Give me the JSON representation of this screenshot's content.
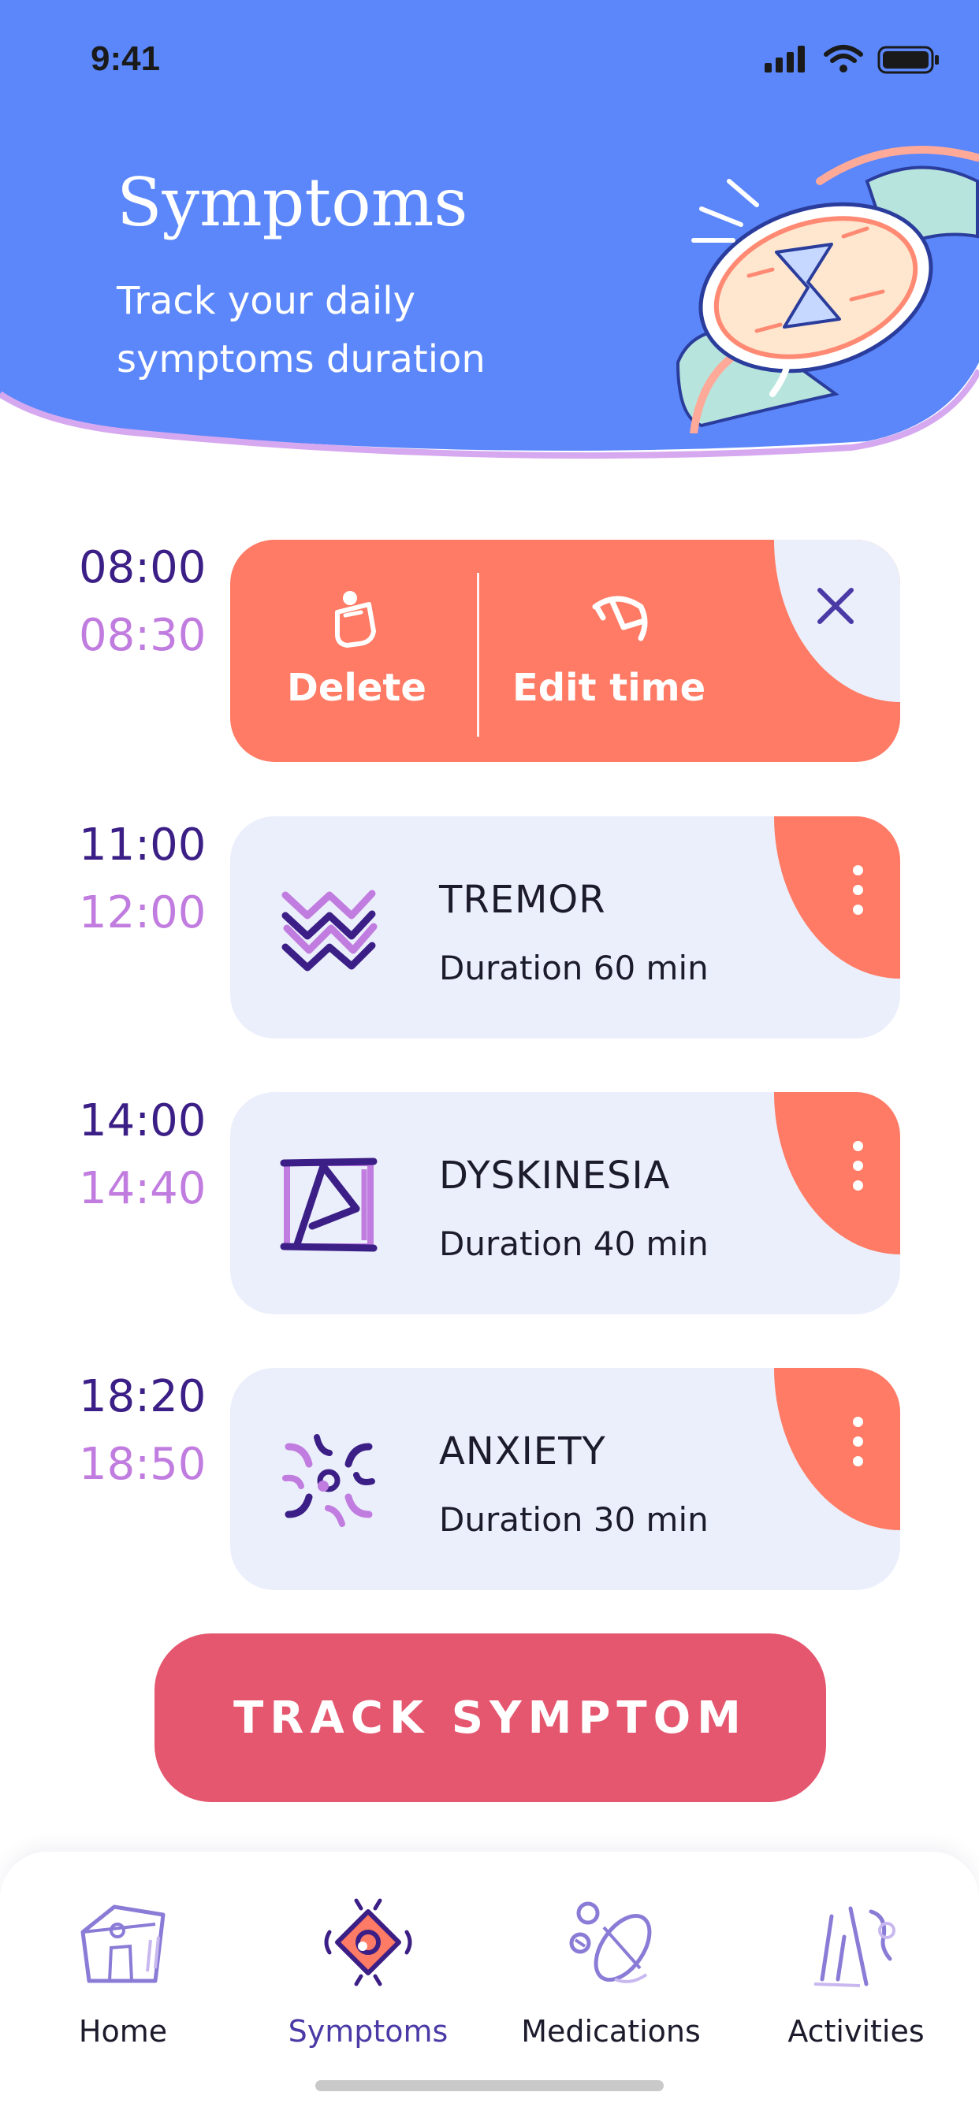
{
  "status_bar": {
    "time": "9:41"
  },
  "header": {
    "title": "Symptoms",
    "subtitle": "Track your daily symptoms duration"
  },
  "swipe_entry": {
    "start": "08:00",
    "end": "08:30",
    "delete_label": "Delete",
    "edit_label": "Edit time"
  },
  "entries": [
    {
      "start": "11:00",
      "end": "12:00",
      "name": "TREMOR",
      "duration": "Duration 60 min",
      "icon": "tremor-icon"
    },
    {
      "start": "14:00",
      "end": "14:40",
      "name": "DYSKINESIA",
      "duration": "Duration 40 min",
      "icon": "dyskinesia-icon"
    },
    {
      "start": "18:20",
      "end": "18:50",
      "name": "ANXIETY",
      "duration": "Duration 30 min",
      "icon": "anxiety-icon"
    }
  ],
  "track_button": "TRACK SYMPTOM",
  "nav": [
    {
      "label": "Home",
      "icon": "home-icon",
      "active": false
    },
    {
      "label": "Symptoms",
      "icon": "symptoms-icon",
      "active": true
    },
    {
      "label": "Medications",
      "icon": "medications-icon",
      "active": false
    },
    {
      "label": "Activities",
      "icon": "activities-icon",
      "active": false
    }
  ],
  "colors": {
    "header": "#5b87fa",
    "accent": "#ff7b65",
    "button": "#e5566f",
    "card": "#ebeffb",
    "time_start": "#3c1f86",
    "time_end": "#c17ce0"
  }
}
